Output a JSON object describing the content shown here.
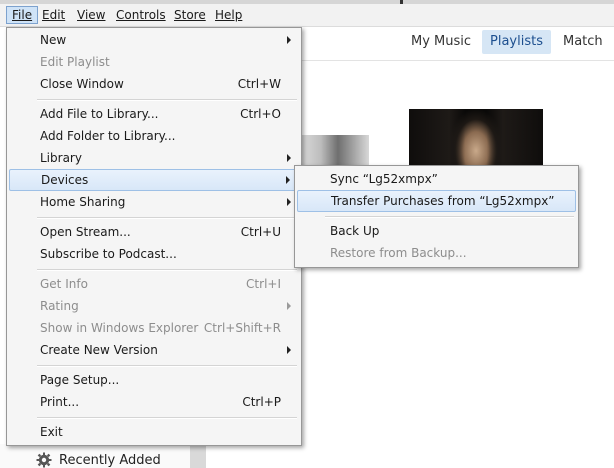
{
  "menubar": {
    "items": [
      {
        "label": "File",
        "underline": "F"
      },
      {
        "label": "Edit",
        "underline": "E"
      },
      {
        "label": "View",
        "underline": "V"
      },
      {
        "label": "Controls",
        "underline": "C"
      },
      {
        "label": "Store",
        "underline": "S"
      },
      {
        "label": "Help",
        "underline": "H"
      }
    ]
  },
  "view_tabs": {
    "my_music": "My Music",
    "playlists": "Playlists",
    "match": "Match"
  },
  "file_menu": {
    "new": {
      "label": "New"
    },
    "edit_playlist": {
      "label": "Edit Playlist"
    },
    "close_window": {
      "label": "Close Window",
      "shortcut": "Ctrl+W"
    },
    "add_file": {
      "label": "Add File to Library...",
      "shortcut": "Ctrl+O"
    },
    "add_folder": {
      "label": "Add Folder to Library..."
    },
    "library": {
      "label": "Library"
    },
    "devices": {
      "label": "Devices"
    },
    "home_sharing": {
      "label": "Home Sharing"
    },
    "open_stream": {
      "label": "Open Stream...",
      "shortcut": "Ctrl+U"
    },
    "subscribe_podcast": {
      "label": "Subscribe to Podcast..."
    },
    "get_info": {
      "label": "Get Info",
      "shortcut": "Ctrl+I"
    },
    "rating": {
      "label": "Rating"
    },
    "show_explorer": {
      "label": "Show in Windows Explorer",
      "shortcut": "Ctrl+Shift+R"
    },
    "create_version": {
      "label": "Create New Version"
    },
    "page_setup": {
      "label": "Page Setup..."
    },
    "print": {
      "label": "Print...",
      "shortcut": "Ctrl+P"
    },
    "exit": {
      "label": "Exit"
    }
  },
  "devices_menu": {
    "sync": "Sync “Lg52xmpx”",
    "transfer": "Transfer Purchases from “Lg52xmpx”",
    "back_up": "Back Up",
    "restore": "Restore from Backup..."
  },
  "sidebar": {
    "recently_added": "Recently Added"
  },
  "colors": {
    "highlight": "#d8e7f8",
    "selected_tab": "#d6e6f5",
    "disabled_text": "#8d8d8d"
  }
}
